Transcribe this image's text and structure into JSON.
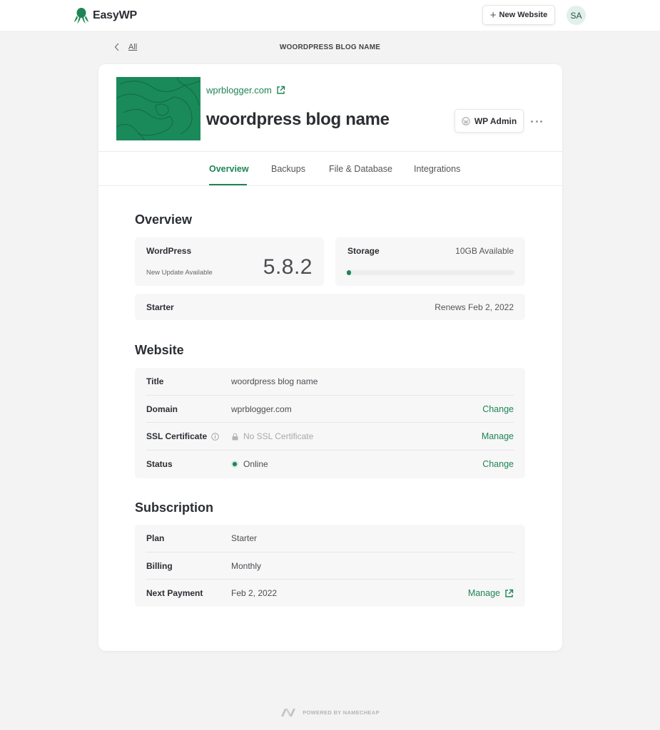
{
  "app": {
    "name": "EasyWP",
    "logo_icon": "octopus-icon",
    "brand_color": "#1f8556"
  },
  "header": {
    "new_website_label": "New Website",
    "avatar_initials": "SA"
  },
  "breadcrumb": {
    "back_label": "All",
    "page_title": "WOORDPRESS BLOG NAME"
  },
  "site": {
    "domain": "wprblogger.com",
    "name": "woordpress blog name",
    "wp_admin_label": "WP Admin",
    "thumbnail_color": "#1a8a5a"
  },
  "tabs": [
    {
      "label": "Overview",
      "active": true
    },
    {
      "label": "Backups",
      "active": false
    },
    {
      "label": "File & Database",
      "active": false
    },
    {
      "label": "Integrations",
      "active": false
    }
  ],
  "overview": {
    "title": "Overview",
    "wordpress": {
      "label": "WordPress",
      "note": "New Update Available",
      "version": "5.8.2"
    },
    "storage": {
      "label": "Storage",
      "available": "10GB Available",
      "used_fraction": 0.02
    },
    "plan": {
      "label": "Starter",
      "renewal": "Renews Feb 2, 2022"
    }
  },
  "website": {
    "title": "Website",
    "rows": [
      {
        "key": "Title",
        "value": "woordpress blog name",
        "action": ""
      },
      {
        "key": "Domain",
        "value": "wprblogger.com",
        "action": "Change"
      },
      {
        "key": "SSL Certificate",
        "value": "No SSL Certificate",
        "action": "Manage"
      },
      {
        "key": "Status",
        "value": "Online",
        "action": "Change"
      }
    ]
  },
  "subscription": {
    "title": "Subscription",
    "rows": [
      {
        "key": "Plan",
        "value": "Starter",
        "action": ""
      },
      {
        "key": "Billing",
        "value": "Monthly",
        "action": ""
      },
      {
        "key": "Next Payment",
        "value": "Feb 2, 2022",
        "action": "Manage"
      }
    ]
  },
  "footer": {
    "text": "POWERED BY NAMECHEAP"
  }
}
